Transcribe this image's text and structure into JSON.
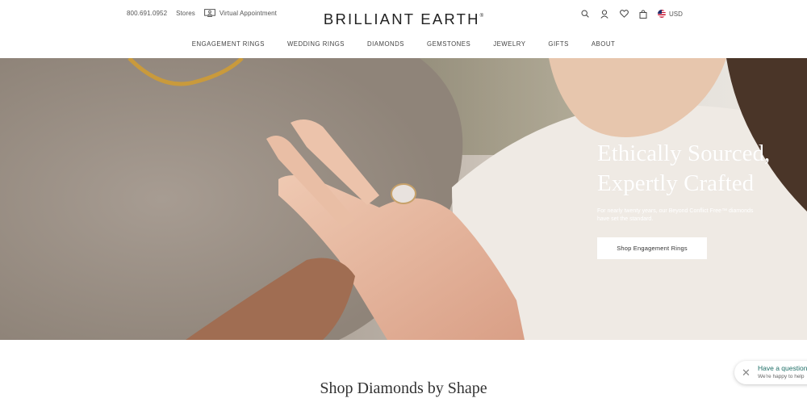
{
  "header": {
    "phone": "800.691.0952",
    "stores_label": "Stores",
    "virtual_appointment_label": "Virtual Appointment",
    "logo_text": "BRILLIANT EARTH",
    "logo_mark": "®",
    "currency": "USD"
  },
  "nav": {
    "items": [
      {
        "label": "ENGAGEMENT RINGS"
      },
      {
        "label": "WEDDING RINGS"
      },
      {
        "label": "DIAMONDS"
      },
      {
        "label": "GEMSTONES"
      },
      {
        "label": "JEWELRY"
      },
      {
        "label": "GIFTS"
      },
      {
        "label": "ABOUT"
      }
    ]
  },
  "hero": {
    "title_line1": "Ethically Sourced,",
    "title_line2": "Expertly Crafted",
    "subtitle": "For nearly twenty years, our Beyond Conflict Free™ diamonds have set the standard.",
    "cta_label": "Shop Engagement Rings"
  },
  "section": {
    "title": "Shop Diamonds by Shape"
  },
  "chat": {
    "close_glyph": "✕",
    "question": "Have a question?",
    "subtext": "We're happy to help"
  },
  "icons": [
    "virtual-appointment-icon",
    "search-icon",
    "account-icon",
    "heart-icon",
    "bag-icon",
    "us-flag-icon"
  ],
  "colors": {
    "chat_accent": "#1f6f67",
    "text_dark": "#222222",
    "button_bg": "#ffffff"
  }
}
